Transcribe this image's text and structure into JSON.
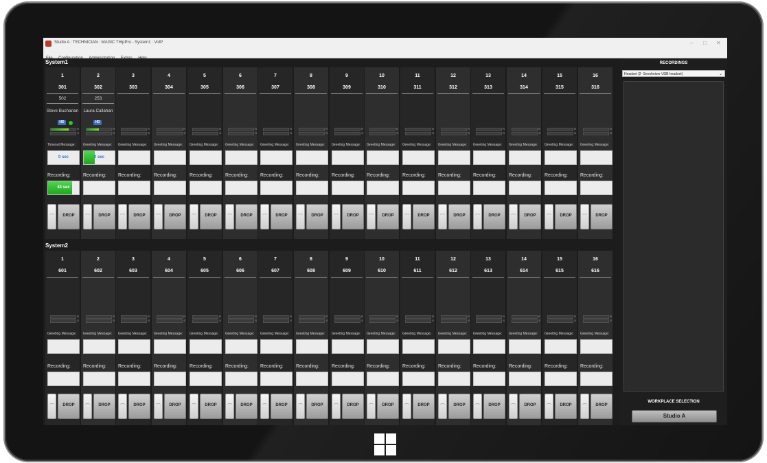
{
  "window": {
    "title": "Studio A : TECHNICIAN : MAGIC THipPro - System1 : VoIP",
    "min": "–",
    "max": "□",
    "close": "✕"
  },
  "menu": [
    "File",
    "Configuration",
    "Administration",
    "Extras",
    "Help"
  ],
  "system1": {
    "label": "System1",
    "channels": [
      {
        "num": "1",
        "ext": "301",
        "line": "502",
        "name": "Steve Buchanan",
        "hd": true,
        "active": true,
        "msg_label": "Timeout Message:",
        "msg_value": "0 sec",
        "msg_fill": 0,
        "rec_label": "Recording:",
        "rec_value": "43 sec",
        "rec_fill": 0.78
      },
      {
        "num": "2",
        "ext": "302",
        "line": "253",
        "name": "Laura Callahan",
        "hd": true,
        "active": false,
        "msg_label": "Greeting Message:",
        "msg_value": "0 sec",
        "msg_fill": 0.35,
        "rec_label": "Recording:",
        "rec_value": "",
        "rec_fill": 0
      },
      {
        "num": "3",
        "ext": "303",
        "msg_label": "Greeting Message:",
        "rec_label": "Recording:"
      },
      {
        "num": "4",
        "ext": "304",
        "msg_label": "Greeting Message:",
        "rec_label": "Recording:"
      },
      {
        "num": "5",
        "ext": "305",
        "msg_label": "Greeting Message:",
        "rec_label": "Recording:"
      },
      {
        "num": "6",
        "ext": "306",
        "msg_label": "Greeting Message:",
        "rec_label": "Recording:"
      },
      {
        "num": "7",
        "ext": "307",
        "msg_label": "Greeting Message:",
        "rec_label": "Recording:"
      },
      {
        "num": "8",
        "ext": "308",
        "msg_label": "Greeting Message:",
        "rec_label": "Recording:"
      },
      {
        "num": "9",
        "ext": "309",
        "msg_label": "Greeting Message:",
        "rec_label": "Recording:"
      },
      {
        "num": "10",
        "ext": "310",
        "msg_label": "Greeting Message:",
        "rec_label": "Recording:"
      },
      {
        "num": "11",
        "ext": "311",
        "msg_label": "Greeting Message:",
        "rec_label": "Recording:"
      },
      {
        "num": "12",
        "ext": "312",
        "msg_label": "Greeting Message:",
        "rec_label": "Recording:"
      },
      {
        "num": "13",
        "ext": "313",
        "msg_label": "Greeting Message:",
        "rec_label": "Recording:"
      },
      {
        "num": "14",
        "ext": "314",
        "msg_label": "Greeting Message:",
        "rec_label": "Recording:"
      },
      {
        "num": "15",
        "ext": "315",
        "msg_label": "Greeting Message:",
        "rec_label": "Recording:"
      },
      {
        "num": "16",
        "ext": "316",
        "msg_label": "Greeting Message:",
        "rec_label": "Recording:"
      }
    ]
  },
  "system2": {
    "label": "System2",
    "channels": [
      {
        "num": "1",
        "ext": "601",
        "msg_label": "Greeting Message:",
        "rec_label": "Recording:"
      },
      {
        "num": "2",
        "ext": "602",
        "msg_label": "Greeting Message:",
        "rec_label": "Recording:"
      },
      {
        "num": "3",
        "ext": "603",
        "msg_label": "Greeting Message:",
        "rec_label": "Recording:"
      },
      {
        "num": "4",
        "ext": "604",
        "msg_label": "Greeting Message:",
        "rec_label": "Recording:"
      },
      {
        "num": "5",
        "ext": "605",
        "msg_label": "Greeting Message:",
        "rec_label": "Recording:"
      },
      {
        "num": "6",
        "ext": "606",
        "msg_label": "Greeting Message:",
        "rec_label": "Recording:"
      },
      {
        "num": "7",
        "ext": "607",
        "msg_label": "Greeting Message:",
        "rec_label": "Recording:"
      },
      {
        "num": "8",
        "ext": "608",
        "msg_label": "Greeting Message:",
        "rec_label": "Recording:"
      },
      {
        "num": "9",
        "ext": "609",
        "msg_label": "Greeting Message:",
        "rec_label": "Recording:"
      },
      {
        "num": "10",
        "ext": "610",
        "msg_label": "Greeting Message:",
        "rec_label": "Recording:"
      },
      {
        "num": "11",
        "ext": "611",
        "msg_label": "Greeting Message:",
        "rec_label": "Recording:"
      },
      {
        "num": "12",
        "ext": "612",
        "msg_label": "Greeting Message:",
        "rec_label": "Recording:"
      },
      {
        "num": "13",
        "ext": "613",
        "msg_label": "Greeting Message:",
        "rec_label": "Recording:"
      },
      {
        "num": "14",
        "ext": "614",
        "msg_label": "Greeting Message:",
        "rec_label": "Recording:"
      },
      {
        "num": "15",
        "ext": "615",
        "msg_label": "Greeting Message:",
        "rec_label": "Recording:"
      },
      {
        "num": "16",
        "ext": "616",
        "msg_label": "Greeting Message:",
        "rec_label": "Recording:"
      }
    ]
  },
  "common": {
    "drop_label": "DROP",
    "hd_label": "HD",
    "meter_r": "R",
    "meter_s": "S",
    "headphone_icon": "headphone-icon"
  },
  "recordings": {
    "title": "RECORDINGS",
    "device": "Headset (2- Sennheiser USB headset)"
  },
  "workplace": {
    "title": "WORKPLACE SELECTION",
    "button": "Studio A"
  },
  "colors": {
    "active_green": "#22cc22",
    "hd_blue": "#3a6fc4",
    "timer_text_blue": "#2a78c9"
  }
}
